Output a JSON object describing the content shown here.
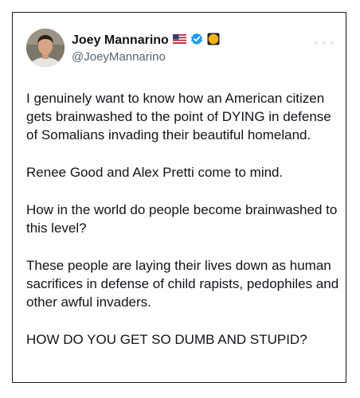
{
  "author": {
    "display_name": "Joey Mannarino",
    "handle": "@JoeyMannarino",
    "flag_icon": "us-flag-icon",
    "verified_icon": "verified-badge-icon",
    "affiliate_icon": "gold-circle-icon",
    "verified_color": "#1d9bf0"
  },
  "tweet": {
    "paragraphs": [
      "I genuinely want to know how an American citizen gets brainwashed to the point of DYING in defense of Somalians invading their beautiful homeland.",
      "Renee Good and Alex Pretti come to mind.",
      "How in the world do people become brainwashed to this level?",
      "These people are laying their lives down as human sacrifices in defense of child rapists, pedophiles and other awful invaders.",
      "HOW DO YOU GET SO DUMB AND STUPID?"
    ]
  }
}
